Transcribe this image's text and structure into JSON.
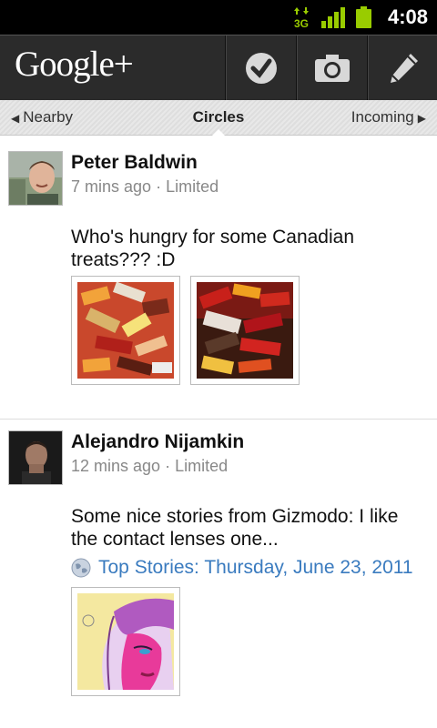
{
  "status_bar": {
    "time": "4:08",
    "network": "3G"
  },
  "app": {
    "logo": "Google+"
  },
  "tabs": {
    "left": "Nearby",
    "center": "Circles",
    "right": "Incoming"
  },
  "posts": [
    {
      "author": "Peter Baldwin",
      "time": "7 mins ago",
      "separator": "·",
      "visibility": "Limited",
      "text": "Who's hungry for some Canadian treats??? :D"
    },
    {
      "author": "Alejandro Nijamkin",
      "time": "12 mins ago",
      "separator": "·",
      "visibility": "Limited",
      "text": "Some nice stories from Gizmodo: I like the contact lenses one...",
      "link": "Top Stories: Thursday, June 23, 2011"
    }
  ],
  "colors": {
    "accent_link": "#3a7bbf",
    "signal": "#99cc00",
    "actionbar": "#2b2b2b"
  }
}
